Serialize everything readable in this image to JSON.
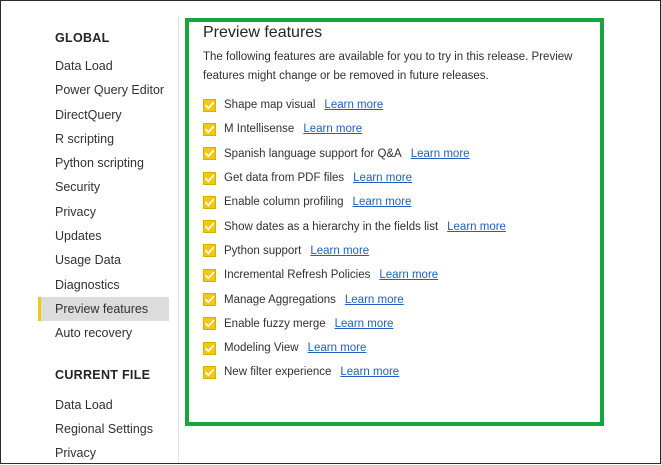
{
  "sidebar": {
    "global_title": "GLOBAL",
    "global_items": [
      {
        "label": "Data Load"
      },
      {
        "label": "Power Query Editor"
      },
      {
        "label": "DirectQuery"
      },
      {
        "label": "R scripting"
      },
      {
        "label": "Python scripting"
      },
      {
        "label": "Security"
      },
      {
        "label": "Privacy"
      },
      {
        "label": "Updates"
      },
      {
        "label": "Usage Data"
      },
      {
        "label": "Diagnostics"
      },
      {
        "label": "Preview features",
        "active": true
      },
      {
        "label": "Auto recovery"
      }
    ],
    "current_title": "CURRENT FILE",
    "current_items": [
      {
        "label": "Data Load"
      },
      {
        "label": "Regional Settings"
      },
      {
        "label": "Privacy"
      }
    ]
  },
  "panel": {
    "title": "Preview features",
    "description": "The following features are available for you to try in this release. Preview features might change or be removed in future releases.",
    "features": [
      {
        "label": "Shape map visual",
        "link": "Learn more",
        "checked": true
      },
      {
        "label": "M Intellisense",
        "link": "Learn more",
        "checked": true
      },
      {
        "label": "Spanish language support for Q&A",
        "link": "Learn more",
        "checked": true
      },
      {
        "label": "Get data from PDF files",
        "link": "Learn more",
        "checked": true
      },
      {
        "label": "Enable column profiling",
        "link": "Learn more",
        "checked": true
      },
      {
        "label": "Show dates as a hierarchy in the fields list",
        "link": "Learn more",
        "checked": true
      },
      {
        "label": "Python support",
        "link": "Learn more",
        "checked": true
      },
      {
        "label": "Incremental Refresh Policies",
        "link": "Learn more",
        "checked": true
      },
      {
        "label": "Manage Aggregations",
        "link": "Learn more",
        "checked": true
      },
      {
        "label": "Enable fuzzy merge",
        "link": "Learn more",
        "checked": true
      },
      {
        "label": "Modeling View",
        "link": "Learn more",
        "checked": true
      },
      {
        "label": "New filter experience",
        "link": "Learn more",
        "checked": true
      }
    ]
  },
  "colors": {
    "checkbox_fill": "#f2c811",
    "highlight_border": "#15a63c",
    "link": "#1f5fbf",
    "active_item_bg": "#dcdcdc"
  },
  "icons": {
    "checkbox": "checkmark-icon"
  }
}
